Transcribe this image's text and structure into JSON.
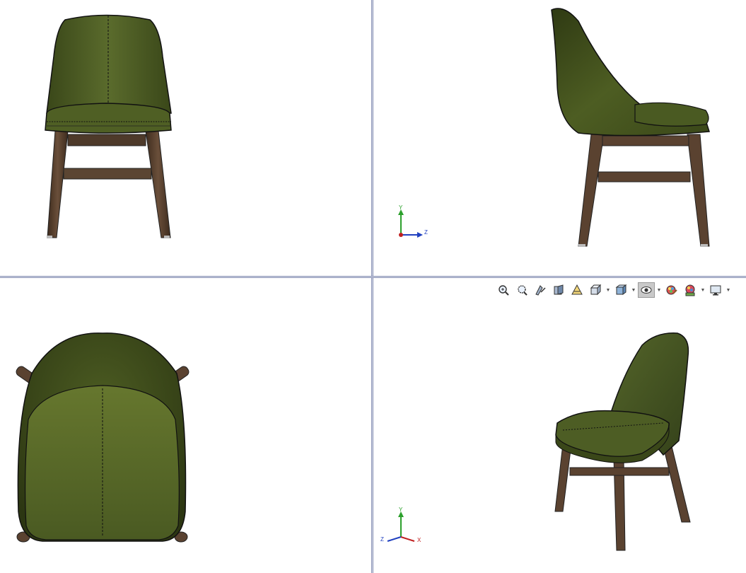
{
  "triad_front_right": {
    "y": "Y",
    "z": "Z"
  },
  "triad_iso": {
    "y": "Y",
    "z": "Z",
    "x": "X"
  },
  "colors": {
    "fabric": "#4a5a22",
    "fabric_dark": "#2e3814",
    "wood": "#5a4230",
    "divider": "#8d96b8"
  },
  "toolbar": {
    "buttons": [
      {
        "icon": "zoom-to-fit-icon"
      },
      {
        "icon": "zoom-to-area-icon"
      },
      {
        "icon": "previous-view-icon"
      },
      {
        "icon": "section-view-icon"
      },
      {
        "icon": "dynamic-annotation-icon"
      },
      {
        "icon": "view-orientation-icon",
        "dropdown": true
      },
      {
        "icon": "display-style-icon",
        "dropdown": true
      },
      {
        "icon": "hide-show-items-icon",
        "dropdown": true,
        "active": true
      },
      {
        "icon": "edit-appearance-icon"
      },
      {
        "icon": "apply-scene-icon",
        "dropdown": true
      },
      {
        "icon": "view-settings-icon",
        "dropdown": true
      }
    ]
  }
}
